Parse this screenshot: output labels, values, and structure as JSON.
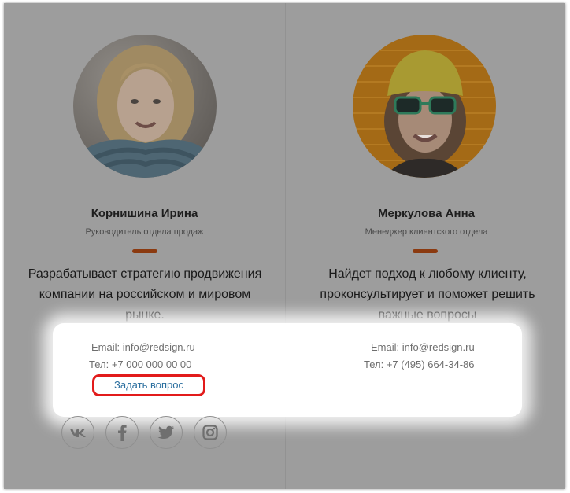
{
  "team": [
    {
      "name": "Корнишина Ирина",
      "role": "Руководитель отдела продаж",
      "description": "Разрабатывает стратегию продвижения компании на российском и мировом рынке.",
      "email": "Email: info@redsign.ru",
      "phone": "Тел: +7 000 000 00 00",
      "ask_link": "Задать вопрос",
      "photo_icon": "woman-scarf-photo"
    },
    {
      "name": "Меркулова Анна",
      "role": "Менеджер клиентского отдела",
      "description": "Найдет подход к любому клиенту, проконсультирует и поможет решить важные вопросы",
      "email": "Email: info@redsign.ru",
      "phone": "Тел: +7 (495) 664-34-86",
      "photo_icon": "woman-yellow-hat-photo"
    }
  ],
  "social_icons": [
    "vk-icon",
    "facebook-icon",
    "twitter-icon",
    "instagram-icon"
  ],
  "colors": {
    "overlay": "#9d9d9d",
    "accent": "#8b3a10",
    "link": "#2b6f9f",
    "highlight": "#e21b1b"
  }
}
